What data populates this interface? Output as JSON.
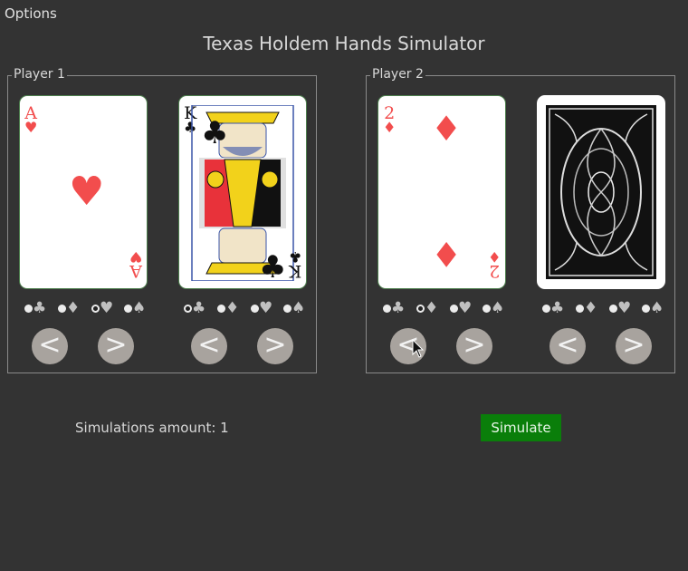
{
  "menu": {
    "options_label": "Options"
  },
  "title": "Texas Holdem Hands Simulator",
  "players": [
    {
      "label": "Player 1",
      "cards": [
        {
          "rank": "A",
          "suit": "♥",
          "face": "ace-of-hearts",
          "suit_selected": "hearts"
        },
        {
          "rank": "K",
          "suit": "♣",
          "face": "king-of-clubs",
          "suit_selected": "clubs"
        }
      ]
    },
    {
      "label": "Player 2",
      "cards": [
        {
          "rank": "2",
          "suit": "♦",
          "face": "two-of-diamonds",
          "suit_selected": "diamonds"
        },
        {
          "rank": "",
          "suit": "",
          "face": "card-back",
          "suit_selected": "none"
        }
      ]
    }
  ],
  "suit_options": [
    "♣",
    "♦",
    "♥",
    "♠"
  ],
  "nav": {
    "prev": "<",
    "next": ">"
  },
  "simulation": {
    "amount_label": "Simulations amount: 1",
    "button_label": "Simulate"
  },
  "colors": {
    "background": "#333333",
    "red_suit": "#f24d4d",
    "simulate_button": "#0a7e0a"
  }
}
